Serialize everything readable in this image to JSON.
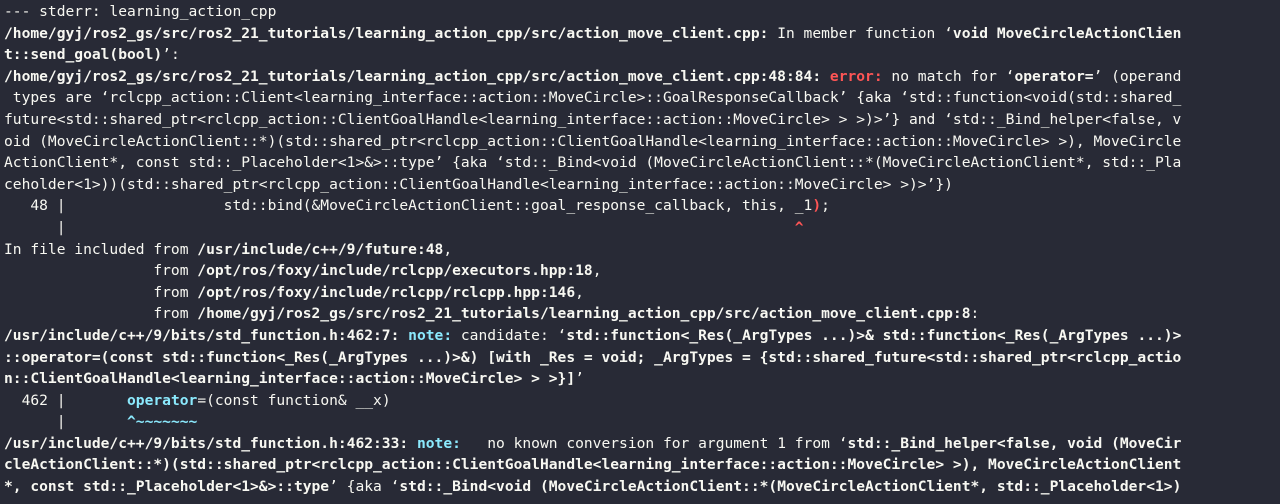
{
  "lines": {
    "l1": "--- stderr: learning_action_cpp",
    "l2_path": "/home/gyj/ros2_gs/src/ros2_21_tutorials/learning_action_cpp/src/action_move_client.cpp:",
    "l2_rest": " In member function ‘",
    "l2_bold": "void MoveCircleActionClien",
    "l3_bold": "t::send_goal(bool)",
    "l3_rest": "’:",
    "l4_path": "/home/gyj/ros2_gs/src/ros2_21_tutorials/learning_action_cpp/src/action_move_client.cpp:48:84:",
    "l4_error": " error:",
    "l4_rest1": " no match for ‘",
    "l4_bold": "operator=",
    "l4_rest2": "’ (operand",
    "l5": " types are ‘rclcpp_action::Client<learning_interface::action::MoveCircle>::GoalResponseCallback’ {aka ‘std::function<void(std::shared_",
    "l6": "future<std::shared_ptr<rclcpp_action::ClientGoalHandle<learning_interface::action::MoveCircle> > >)>’} and ‘std::_Bind_helper<false, v",
    "l7": "oid (MoveCircleActionClient::*)(std::shared_ptr<rclcpp_action::ClientGoalHandle<learning_interface::action::MoveCircle> >), MoveCircle",
    "l8": "ActionClient*, const std::_Placeholder<1>&>::type’ {aka ‘std::_Bind<void (MoveCircleActionClient::*(MoveCircleActionClient*, std::_Pla",
    "l9": "ceholder<1>))(std::shared_ptr<rclcpp_action::ClientGoalHandle<learning_interface::action::MoveCircle> >)>’})",
    "l10_pre": "   48 |                  std::bind(&MoveCircleActionClient::goal_response_callback, this, _1",
    "l10_red": ")",
    "l10_post": ";",
    "l11_pre": "      |                                                                                   ",
    "l11_caret": "^",
    "l12_pre": "In file included from ",
    "l12_bold": "/usr/include/c++/9/future:48",
    "l12_post": ",",
    "l13_pre": "                 from ",
    "l13_bold": "/opt/ros/foxy/include/rclcpp/executors.hpp:18",
    "l13_post": ",",
    "l14_pre": "                 from ",
    "l14_bold": "/opt/ros/foxy/include/rclcpp/rclcpp.hpp:146",
    "l14_post": ",",
    "l15_pre": "                 from ",
    "l15_bold": "/home/gyj/ros2_gs/src/ros2_21_tutorials/learning_action_cpp/src/action_move_client.cpp:8",
    "l15_post": ":",
    "l16_path": "/usr/include/c++/9/bits/std_function.h:462:7:",
    "l16_note": " note:",
    "l16_rest1": " candidate: ‘",
    "l16_bold": "std::function<_Res(_ArgTypes ...)>& std::function<_Res(_ArgTypes ...)>",
    "l17_bold": "::operator=(const std::function<_Res(_ArgTypes ...)>&) [with _Res = void; _ArgTypes = {std::shared_future<std::shared_ptr<rclcpp_actio",
    "l18_bold": "n::ClientGoalHandle<learning_interface::action::MoveCircle> > >}]",
    "l18_rest": "’",
    "l19_pre": "  462 |       ",
    "l19_op": "operator",
    "l19_post": "=(const function& __x)",
    "l20_pre": "      |       ",
    "l20_tilde": "^~~~~~~~",
    "l21_path": "/usr/include/c++/9/bits/std_function.h:462:33:",
    "l21_note": " note:",
    "l21_rest1": "   no known conversion for argument 1 from ‘",
    "l21_bold": "std::_Bind_helper<false, void (MoveCir",
    "l22_bold": "cleActionClient::*)(std::shared_ptr<rclcpp_action::ClientGoalHandle<learning_interface::action::MoveCircle> >), MoveCircleActionClient",
    "l23_bold1": "*, const std::_Placeholder<1>&>::type",
    "l23_rest": "’ {aka ‘",
    "l23_bold2": "std::_Bind<void (MoveCircleActionClient::*(MoveCircleActionClient*, std::_Placeholder<1>)"
  },
  "colors": {
    "background": "#282a36",
    "foreground": "#f8f8f2",
    "error": "#ff5555",
    "note": "#8be9fd"
  }
}
